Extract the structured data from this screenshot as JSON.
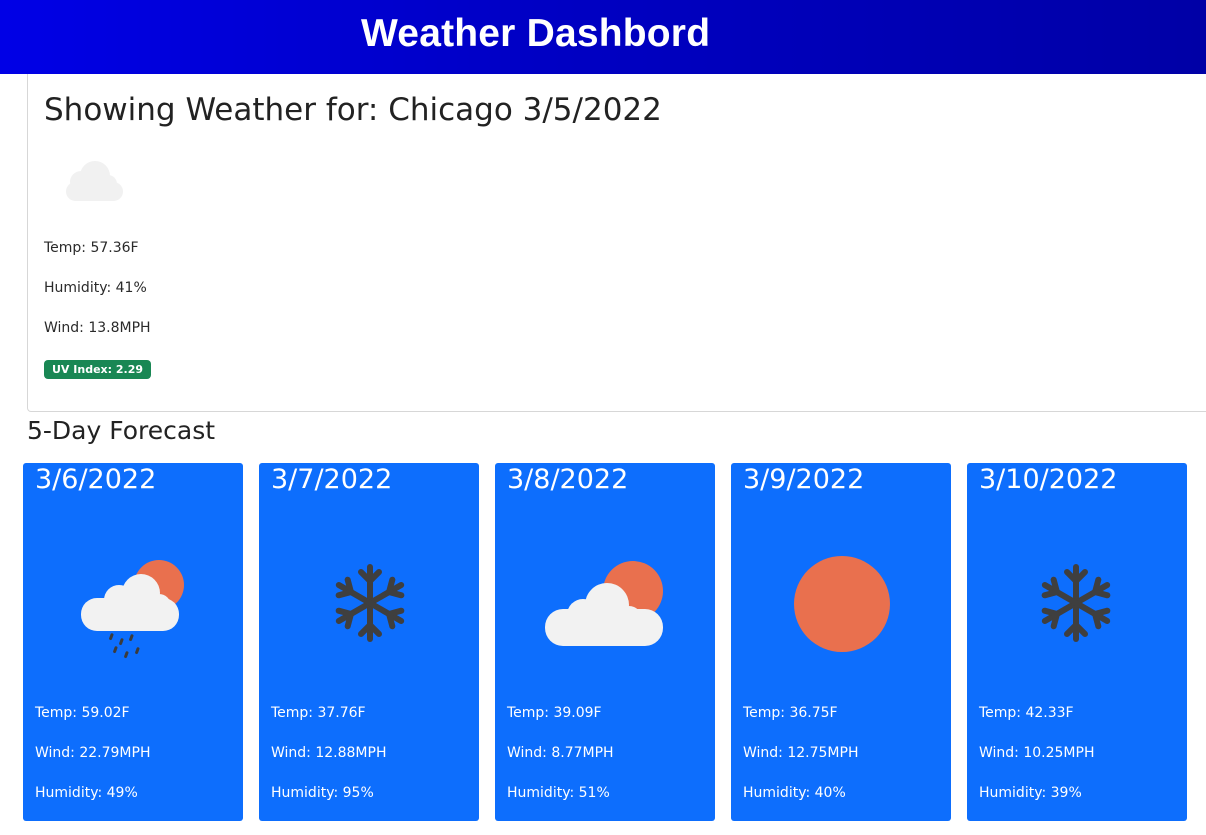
{
  "header": {
    "title": "Weather Dashbord"
  },
  "current": {
    "title": "Showing Weather for: Chicago 3/5/2022",
    "icon": "cloud-icon",
    "temp": "Temp: 57.36F",
    "humidity": "Humidity: 41%",
    "wind": "Wind: 13.8MPH",
    "uv": "UV Index: 2.29",
    "uv_color": "#198754"
  },
  "forecast": {
    "heading": "5-Day Forecast",
    "card_color": "#0d6efd",
    "days": [
      {
        "date": "3/6/2022",
        "icon": "rain-cloud-sun-icon",
        "temp": "Temp: 59.02F",
        "wind": "Wind: 22.79MPH",
        "humidity": "Humidity: 49%"
      },
      {
        "date": "3/7/2022",
        "icon": "snowflake-icon",
        "temp": "Temp: 37.76F",
        "wind": "Wind: 12.88MPH",
        "humidity": "Humidity: 95%"
      },
      {
        "date": "3/8/2022",
        "icon": "cloud-sun-icon",
        "temp": "Temp: 39.09F",
        "wind": "Wind: 8.77MPH",
        "humidity": "Humidity: 51%"
      },
      {
        "date": "3/9/2022",
        "icon": "sun-icon",
        "temp": "Temp: 36.75F",
        "wind": "Wind: 12.75MPH",
        "humidity": "Humidity: 40%"
      },
      {
        "date": "3/10/2022",
        "icon": "snowflake-icon",
        "temp": "Temp: 42.33F",
        "wind": "Wind: 10.25MPH",
        "humidity": "Humidity: 39%"
      }
    ]
  }
}
